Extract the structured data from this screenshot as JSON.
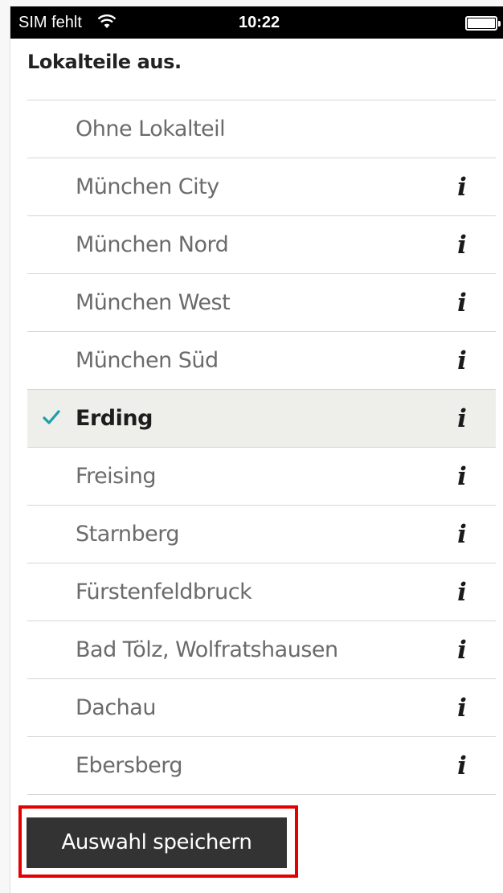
{
  "status_bar": {
    "carrier": "SIM fehlt",
    "time": "10:22"
  },
  "header": {
    "title": "Lokalteile aus."
  },
  "list": {
    "items": [
      {
        "label": "Ohne Lokalteil",
        "selected": false,
        "has_info": false
      },
      {
        "label": "München City",
        "selected": false,
        "has_info": true
      },
      {
        "label": "München Nord",
        "selected": false,
        "has_info": true
      },
      {
        "label": "München West",
        "selected": false,
        "has_info": true
      },
      {
        "label": "München Süd",
        "selected": false,
        "has_info": true
      },
      {
        "label": "Erding",
        "selected": true,
        "has_info": true
      },
      {
        "label": "Freising",
        "selected": false,
        "has_info": true
      },
      {
        "label": "Starnberg",
        "selected": false,
        "has_info": true
      },
      {
        "label": "Fürstenfeldbruck",
        "selected": false,
        "has_info": true
      },
      {
        "label": "Bad Tölz, Wolfratshausen",
        "selected": false,
        "has_info": true
      },
      {
        "label": "Dachau",
        "selected": false,
        "has_info": true
      },
      {
        "label": "Ebersberg",
        "selected": false,
        "has_info": true
      }
    ],
    "info_glyph": "i",
    "info_icon": "info-icon",
    "check_icon": "checkmark-icon",
    "check_color": "#1a9fa8"
  },
  "footer": {
    "save_label": "Auswahl speichern",
    "highlight_color": "#e30000"
  }
}
